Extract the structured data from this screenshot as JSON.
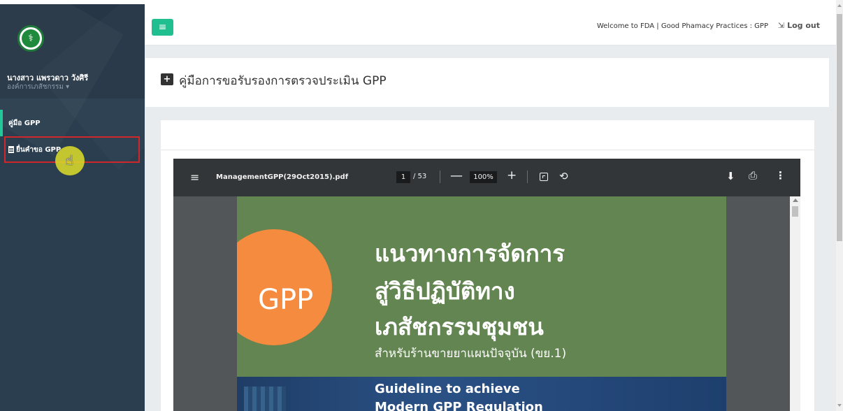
{
  "sidebar": {
    "user_name": "นางสาว แพรวดาว วังศิรี",
    "user_role": "องค์การเภสัชกรรม ▾",
    "items": [
      {
        "label": "คู่มือ GPP",
        "active": true
      },
      {
        "label": "ยื่นคำขอ GPP",
        "highlighted": true
      }
    ]
  },
  "header": {
    "menu_icon": "≡",
    "welcome_text": "Welcome to FDA | Good Phamacy Practices : GPP",
    "logout_label": "Log out",
    "logout_icon": "⇲"
  },
  "page": {
    "title": "คู่มือการขอรับรองการตรวจประเมิน GPP",
    "title_icon": "+"
  },
  "pdf_viewer": {
    "filename": "ManagementGPP(29Oct2015).pdf",
    "current_page": "1",
    "total_pages": "/ 53",
    "zoom": "100%",
    "menu_icon": "≡",
    "minus_icon": "—",
    "plus_icon": "+",
    "rotate_icon": "⟲",
    "download_icon": "⬇",
    "print_icon": "⎙",
    "more_icon": "⋮"
  },
  "document": {
    "badge": "GPP",
    "title_line_1": "แนวทางการจัดการ",
    "title_line_2": "สู่วิธีปฏิบัติทาง",
    "title_line_3": "เภสัชกรรมชุมชน",
    "subtitle": "สำหรับร้านขายยาแผนปัจจุบัน (ขย.1)",
    "english_line_1": "Guideline to achieve",
    "english_line_2": "Modern GPP Regulation"
  },
  "colors": {
    "sidebar_bg": "#2b3e4f",
    "accent_green": "#1fbf8f",
    "highlight_red": "#d0272a",
    "doc_green": "#638551",
    "doc_orange": "#f58b3f"
  }
}
